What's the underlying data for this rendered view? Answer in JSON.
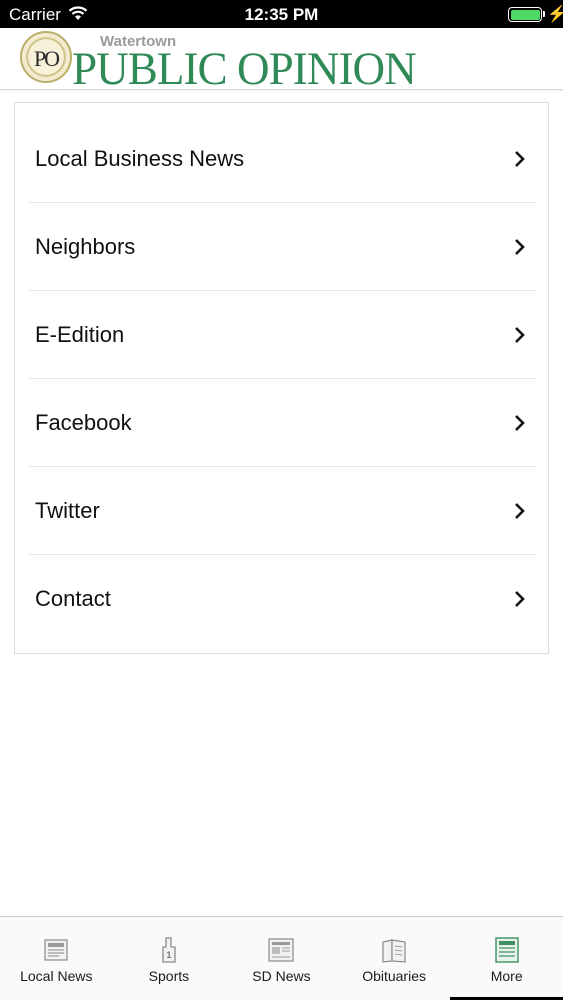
{
  "status_bar": {
    "carrier": "Carrier",
    "time": "12:35 PM",
    "battery_color": "#4cd964"
  },
  "header": {
    "logo_seal_text": "PO",
    "logo_small": "Watertown",
    "logo_big": "PUBLIC OPINION",
    "brand_color": "#2f8a57"
  },
  "menu": {
    "items": [
      {
        "label": "Local Business News",
        "icon": "chevron-right-icon"
      },
      {
        "label": "Neighbors",
        "icon": "chevron-right-icon"
      },
      {
        "label": "E-Edition",
        "icon": "chevron-right-icon"
      },
      {
        "label": "Facebook",
        "icon": "chevron-right-icon"
      },
      {
        "label": "Twitter",
        "icon": "chevron-right-icon"
      },
      {
        "label": "Contact",
        "icon": "chevron-right-icon"
      }
    ]
  },
  "tab_bar": {
    "tabs": [
      {
        "label": "Local News",
        "icon": "local-news-icon",
        "active": false
      },
      {
        "label": "Sports",
        "icon": "foam-finger-icon",
        "active": false
      },
      {
        "label": "SD News",
        "icon": "newspaper-icon",
        "active": false
      },
      {
        "label": "Obituaries",
        "icon": "obituaries-icon",
        "active": false
      },
      {
        "label": "More",
        "icon": "more-icon",
        "active": true
      }
    ],
    "active_icon_color": "#3f8f63"
  }
}
